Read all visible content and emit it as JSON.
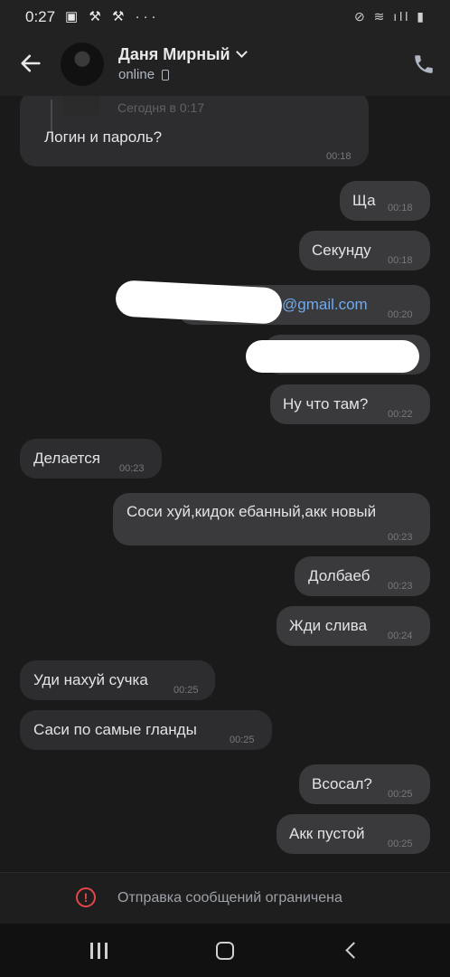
{
  "status_bar": {
    "time": "0:27",
    "left_icons": "▣ ⚒ ⚒ ···",
    "right_icons": "⊘ ≋ ıll ▮"
  },
  "header": {
    "contact_name": "Даня Мирный",
    "status": "online"
  },
  "quoted": {
    "date": "Сегодня в 0:17"
  },
  "messages": [
    {
      "dir": "in",
      "text": "Логин и пароль?",
      "time": "00:18"
    },
    {
      "dir": "out",
      "text": "Ща",
      "time": "00:18"
    },
    {
      "dir": "out",
      "text": "Секунду",
      "time": "00:18"
    },
    {
      "dir": "out",
      "text": "@gmail.com",
      "time": "00:20"
    },
    {
      "dir": "out",
      "text": "",
      "time": ""
    },
    {
      "dir": "out",
      "text": "Ну что там?",
      "time": "00:22"
    },
    {
      "dir": "in",
      "text": "Делается",
      "time": "00:23"
    },
    {
      "dir": "out",
      "text": "Соси хуй,кидок ебанный,акк новый",
      "time": "00:23"
    },
    {
      "dir": "out",
      "text": "Долбаеб",
      "time": "00:23"
    },
    {
      "dir": "out",
      "text": "Жди слива",
      "time": "00:24"
    },
    {
      "dir": "in",
      "text": "Уди нахуй сучка",
      "time": "00:25"
    },
    {
      "dir": "in",
      "text": "Саси по самые гланды",
      "time": "00:25"
    },
    {
      "dir": "out",
      "text": "Всосал?",
      "time": "00:25"
    },
    {
      "dir": "out",
      "text": "Акк пустой",
      "time": "00:25"
    }
  ],
  "restriction": {
    "text": "Отправка сообщений ограничена"
  },
  "icons": {
    "back": "arrow-left-icon",
    "call": "phone-icon",
    "warning": "exclamation-circle-icon",
    "nav_recent": "recent-apps-icon",
    "nav_home": "home-icon",
    "nav_back": "chevron-left-icon"
  },
  "colors": {
    "background": "#1a1a1b",
    "bubble_in": "#2d2d2f",
    "bubble_out": "#3a3a3c",
    "link": "#71aaeb",
    "warning": "#e64646"
  }
}
